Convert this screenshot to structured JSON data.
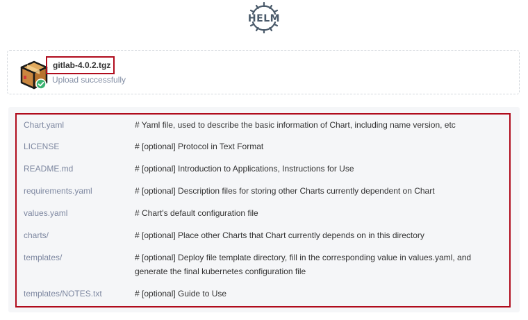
{
  "header": {
    "logo_text": "HELM",
    "logo_icon": "helm-wheel-icon"
  },
  "upload": {
    "file_name": "gitlab-4.0.2.tgz",
    "status": "Upload successfully",
    "icon": "package-box-icon",
    "status_icon": "check-icon"
  },
  "files": [
    {
      "path": "Chart.yaml",
      "description": "#  Yaml file, used to describe the basic information of Chart, including name version, etc"
    },
    {
      "path": "LICENSE",
      "description": "#  [optional]  Protocol in Text Format"
    },
    {
      "path": "README.md",
      "description": "#  [optional]  Introduction to Applications, Instructions for Use"
    },
    {
      "path": "requirements.yaml",
      "description": "#  [optional]  Description files for storing other Charts currently dependent on Chart"
    },
    {
      "path": "values.yaml",
      "description": "#  Chart's default configuration file"
    },
    {
      "path": "charts/",
      "description": "#  [optional]  Place other Charts that Chart currently depends on in this directory"
    },
    {
      "path": "templates/",
      "description": "#  [optional]  Deploy file template directory, fill in the corresponding value in values.yaml, and generate the final kubernetes configuration file"
    },
    {
      "path": "templates/NOTES.txt",
      "description": "#  [optional]  Guide to Use"
    }
  ],
  "colors": {
    "highlight_border": "#b00b1c",
    "path_text": "#7d87a0",
    "panel_bg": "#f5f6f8",
    "success": "#3cb371"
  }
}
